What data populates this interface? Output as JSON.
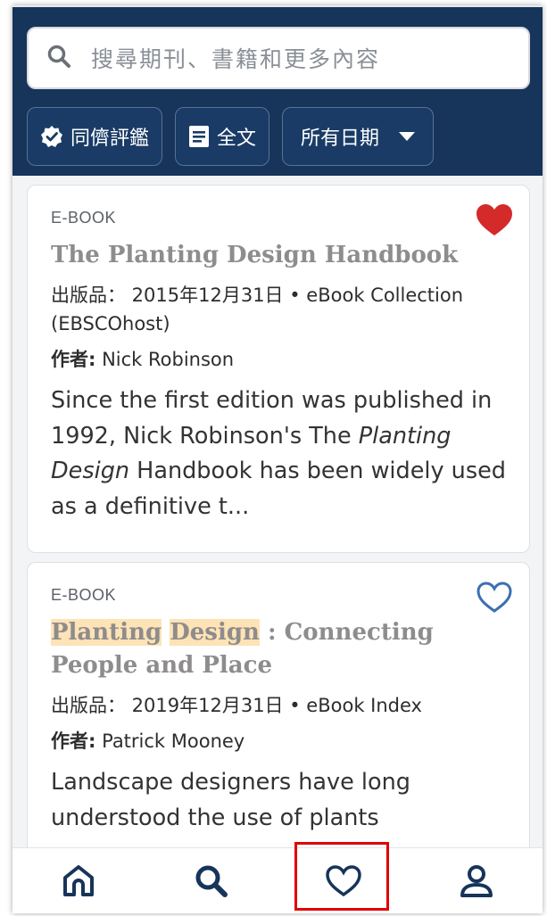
{
  "search": {
    "placeholder": "搜尋期刊、書籍和更多內容"
  },
  "filters": {
    "peer_reviewed": "同儕評鑑",
    "full_text": "全文",
    "date": "所有日期"
  },
  "results": [
    {
      "type": "E-BOOK",
      "favorited": true,
      "title": "The Planting Design Handbook",
      "meta": "出版品： 2015年12月31日 • eBook Collection (EBSCOhost)",
      "author_label": "作者:",
      "author": "Nick Robinson",
      "abstract_pre": "Since the first edition was published in 1992, Nick Robinson's The ",
      "abstract_em": "Planting Design",
      "abstract_post": " Handbook has been widely used as a definitive t..."
    },
    {
      "type": "E-BOOK",
      "favorited": false,
      "title_hl1": "Planting",
      "title_hl2": "Design",
      "title_rest": " : Connecting People and Place",
      "meta": "出版品： 2019年12月31日 • eBook Index",
      "author_label": "作者:",
      "author": "Patrick Mooney",
      "abstract": "Landscape designers have long understood the use of plants"
    }
  ],
  "nav": [
    "home-icon",
    "search-icon",
    "heart-icon",
    "user-icon"
  ],
  "colors": {
    "header_bg": "#17345a",
    "heart_filled": "#d42a2a",
    "heart_outline": "#3d6fb0",
    "highlight": "#fde3b5",
    "annotation_box": "#e00000"
  }
}
